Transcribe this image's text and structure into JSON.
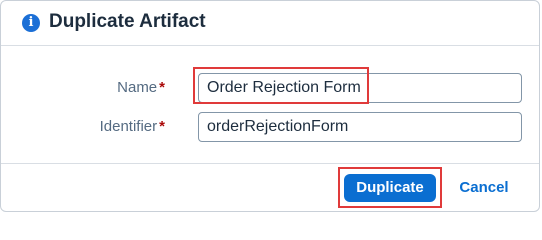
{
  "dialog": {
    "title": "Duplicate Artifact",
    "icon": "info-icon"
  },
  "form": {
    "name": {
      "label": "Name",
      "required_marker": "*",
      "value": "Order Rejection Form"
    },
    "identifier": {
      "label": "Identifier",
      "required_marker": "*",
      "value": "orderRejectionForm"
    }
  },
  "footer": {
    "duplicate_label": "Duplicate",
    "cancel_label": "Cancel"
  },
  "colors": {
    "accent": "#0a6ed1",
    "highlight": "#e03a3a",
    "required": "#aa0808"
  }
}
